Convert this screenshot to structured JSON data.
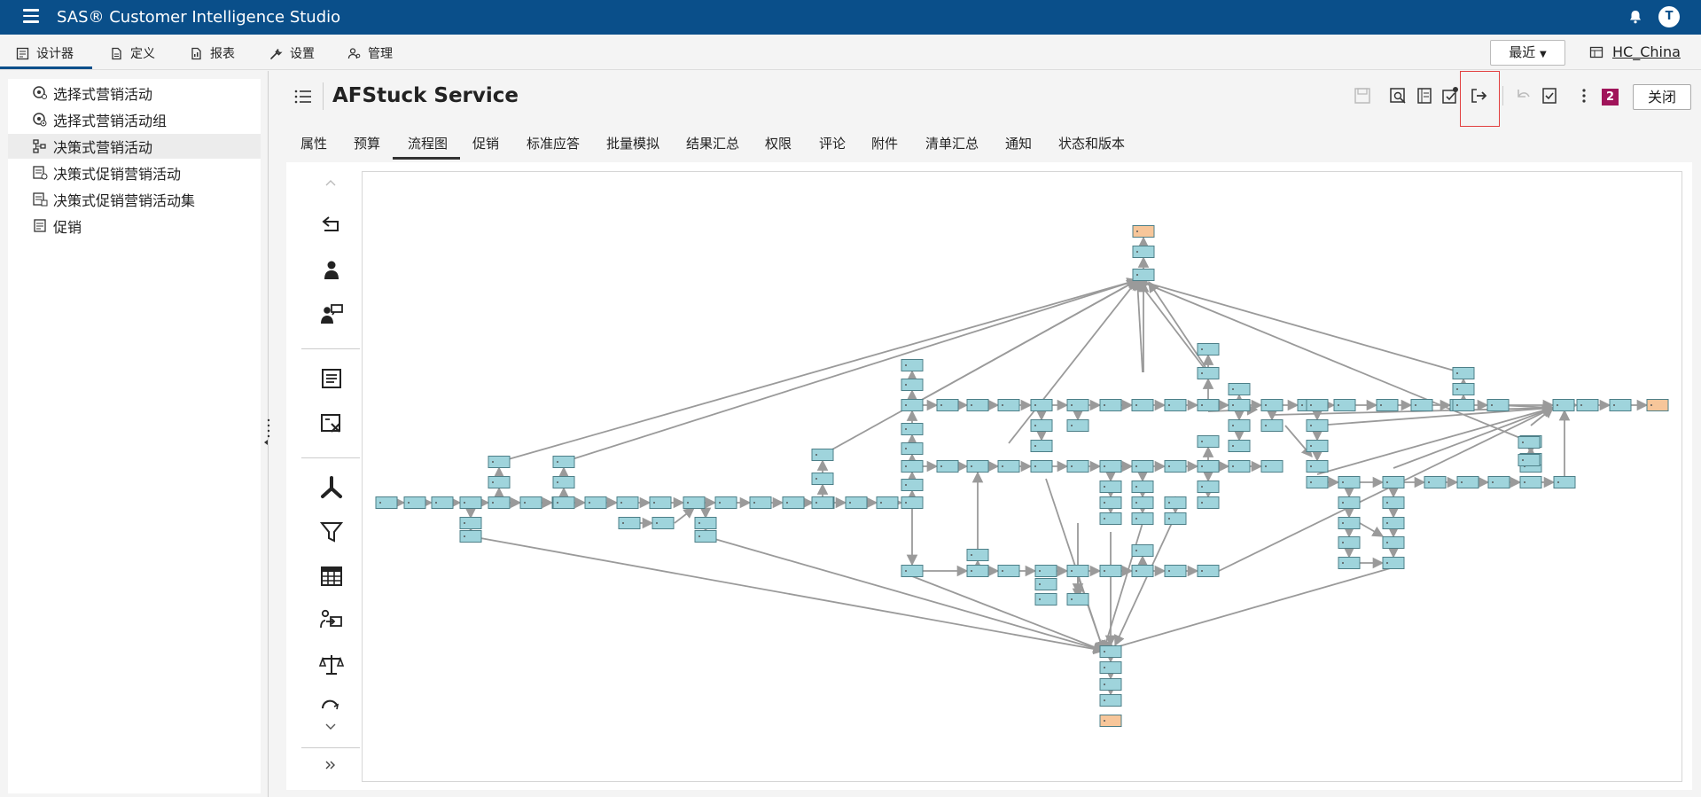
{
  "app": {
    "title": "SAS® Customer Intelligence Studio",
    "user_initial": "T"
  },
  "menubar": {
    "items": [
      {
        "label": "设计器",
        "icon": "designer-icon"
      },
      {
        "label": "定义",
        "icon": "definition-icon"
      },
      {
        "label": "报表",
        "icon": "report-icon"
      },
      {
        "label": "设置",
        "icon": "wrench-icon"
      },
      {
        "label": "管理",
        "icon": "admin-icon"
      }
    ],
    "recent_label": "最近",
    "server_label": "HC_China"
  },
  "sidebar": {
    "items": [
      {
        "label": "选择式营销活动",
        "icon": "campaign-icon",
        "selected": false
      },
      {
        "label": "选择式营销活动组",
        "icon": "campaign-group-icon",
        "selected": false
      },
      {
        "label": "决策式营销活动",
        "icon": "decision-campaign-icon",
        "selected": true
      },
      {
        "label": "决策式促销营销活动",
        "icon": "decision-promo-icon",
        "selected": false
      },
      {
        "label": "决策式促销营销活动集",
        "icon": "decision-promo-set-icon",
        "selected": false
      },
      {
        "label": "促销",
        "icon": "promotion-icon",
        "selected": false
      }
    ]
  },
  "document": {
    "title": "AFStuck Service",
    "notification_count": "2",
    "close_label": "关闭"
  },
  "tabs": {
    "items": [
      "属性",
      "预算",
      "流程图",
      "促销",
      "标准应答",
      "批量模拟",
      "结果汇总",
      "权限",
      "评论",
      "附件",
      "清单汇总",
      "通知",
      "状态和版本"
    ],
    "active": "流程图"
  },
  "colors": {
    "header": "#0a4f8a",
    "node_fill": "#9fd4dc",
    "node_stroke": "#4d7f88",
    "terminal_fill": "#f7c69a",
    "edge": "#9a9a9a",
    "badge": "#a0145a",
    "highlight": "#e24040"
  }
}
